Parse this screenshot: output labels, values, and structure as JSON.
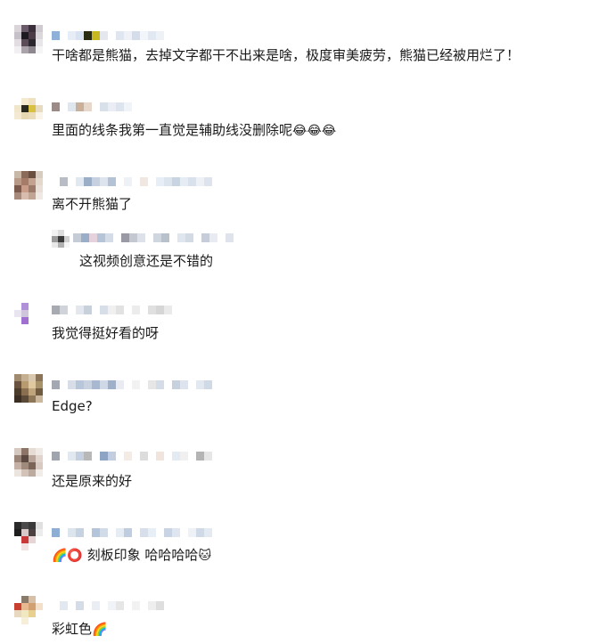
{
  "comments": [
    {
      "text": "干啥都是熊猫，去掉文字都干不出来是啥，极度审美疲劳，熊猫已经被用烂了！"
    },
    {
      "text": "里面的线条我第一直觉是辅助线没删除呢",
      "emoji": "😂😂😂"
    },
    {
      "text": "离不开熊猫了",
      "reply": {
        "text": "这视频创意还是不错的"
      }
    },
    {
      "text": "我觉得挺好看的呀"
    },
    {
      "text": "Edge?"
    },
    {
      "text": "还是原来的好"
    },
    {
      "text": "刻板印象 哈哈哈哈",
      "emoji_before": "🌈⭕",
      "emoji_after": "🐱"
    },
    {
      "text": "彩虹色",
      "emoji": "🌈"
    }
  ]
}
